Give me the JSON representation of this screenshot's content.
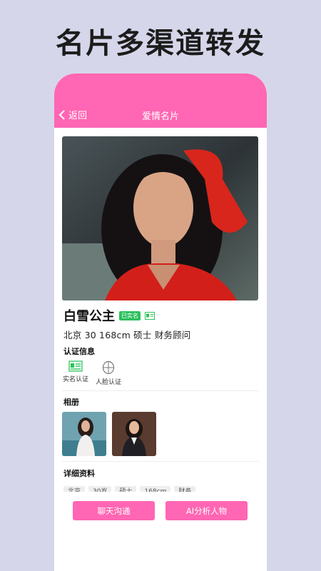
{
  "headline": "名片多渠道转发",
  "nav": {
    "back_label": "返回",
    "title": "爱情名片"
  },
  "profile": {
    "name": "白雪公主",
    "verified_badge": "已实名",
    "info": "北京  30  168cm  硕士  财务顾问"
  },
  "verification": {
    "title": "认证信息",
    "items": [
      {
        "label": "实名认证",
        "icon": "id-card-icon"
      },
      {
        "label": "人脸认证",
        "icon": "face-scan-icon"
      }
    ]
  },
  "album": {
    "title": "相册"
  },
  "details": {
    "title": "详细资料",
    "tags": [
      "北京",
      "30岁",
      "硕士",
      "168cm",
      "财务"
    ]
  },
  "actions": {
    "chat_label": "聊天沟通",
    "ai_label": "AI分析人物"
  },
  "colors": {
    "accent": "#ff66b3",
    "badge_green": "#2bc15b",
    "background": "#d6d6ea"
  }
}
